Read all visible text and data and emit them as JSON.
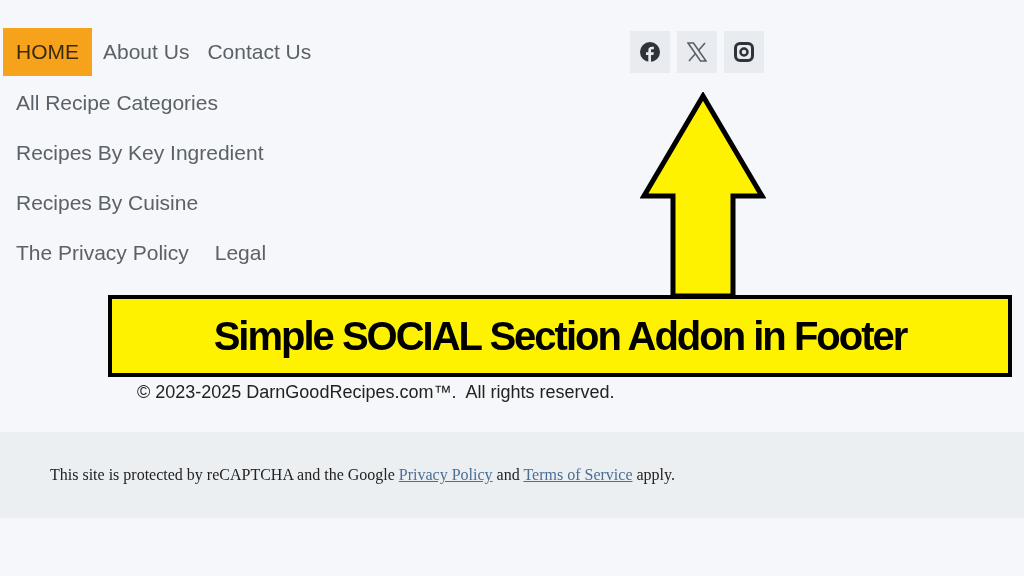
{
  "nav": [
    {
      "label": "HOME",
      "selected": true
    },
    {
      "label": "About Us",
      "selected": false
    },
    {
      "label": "Contact Us",
      "selected": false
    }
  ],
  "link_rows": [
    [
      "All Recipe Categories"
    ],
    [
      "Recipes By Key Ingredient"
    ],
    [
      "Recipes By Cuisine"
    ],
    [
      "The Privacy Policy",
      "Legal"
    ]
  ],
  "social": [
    {
      "kind": "facebook"
    },
    {
      "kind": "x"
    },
    {
      "kind": "instagram"
    }
  ],
  "annotation": {
    "text": "Simple SOCIAL Section Addon in Footer"
  },
  "copyright": "© 2023-2025 DarnGoodRecipes.com™.  All rights reserved.",
  "recaptcha": {
    "before": "This site is protected by reCAPTCHA and the Google",
    "link_1": "Privacy Policy",
    "middle": "and",
    "link_2": "Terms of Service",
    "after": "apply."
  }
}
